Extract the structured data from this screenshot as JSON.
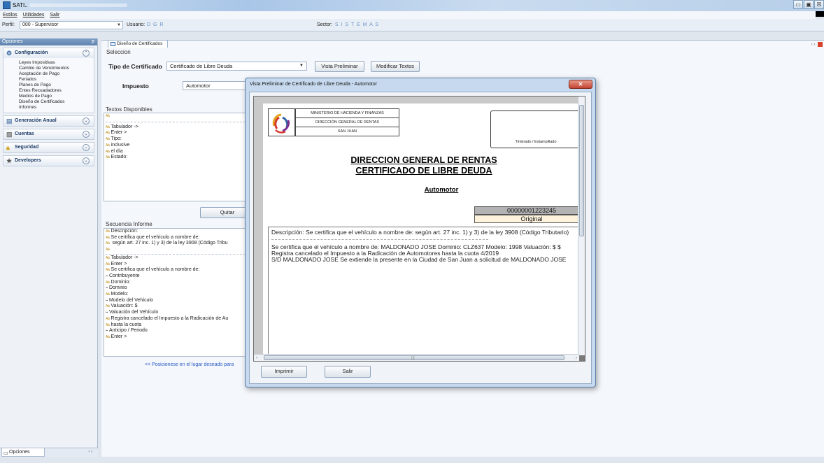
{
  "window": {
    "title": "SATI..",
    "controls": [
      "▭",
      "▣",
      "☒"
    ]
  },
  "menu": [
    "Estilos",
    "Utilidades",
    "Salir"
  ],
  "profile_bar": {
    "perfil_label": "Perfil:",
    "perfil_value": "000 - Supervisor",
    "usuario_label": "Usuario:",
    "usuario_value": "D G R",
    "sector_label": "Sector:",
    "sector_value": "S I S T E M A S"
  },
  "left_panel": {
    "header": "Opciones",
    "pin": "ᵽ",
    "groups": [
      {
        "title": "Configuración",
        "icon": "gear-icon",
        "glyph": "⚙",
        "chevron": "⌃",
        "items": [
          "Leyes Impositivas",
          "Cambio de Vencimientos",
          "Aceptación de Pago",
          "Feriados",
          "Planes de Pago",
          "Entes Recuadadores",
          "Medios de Pago",
          "Diseño de Certificados",
          "Informes"
        ]
      },
      {
        "title": "Generación Anual",
        "icon": "chart-icon",
        "glyph": "▤",
        "chevron": "⌄"
      },
      {
        "title": "Cuentas",
        "icon": "wallet-icon",
        "glyph": "▨",
        "chevron": "⌄"
      },
      {
        "title": "Seguridad",
        "icon": "lock-icon",
        "glyph": "🔒",
        "chevron": "⌄"
      },
      {
        "title": "Developers",
        "icon": "star-icon",
        "glyph": "★",
        "chevron": "⌄"
      }
    ],
    "footer_tab": "Opciones",
    "footer_nav": "‹ ›"
  },
  "document_tab": {
    "label": "Diseño de Certificados",
    "nav": "‹ ›"
  },
  "form": {
    "seleccion_label": "Seleccion",
    "tipo_label": "Tipo de Certificado",
    "tipo_value": "Certificado de Libre Deuda",
    "impuesto_label": "Impuesto",
    "impuesto_value": "Automotor",
    "vista_btn": "Vista Preliminar",
    "modificar_btn": "Modificar Textos",
    "textos_label": "Textos Disponibles",
    "textos": [
      {
        "tk": "Aá",
        "t": ""
      },
      {
        "tk": "Aá",
        "t": "Tabulador ->"
      },
      {
        "tk": "Aá",
        "t": "Enter >"
      },
      {
        "tk": "Aá",
        "t": "Tipo:"
      },
      {
        "tk": "Aá",
        "t": "inclusive"
      },
      {
        "tk": "Aá",
        "t": "el día"
      },
      {
        "tk": "Aá",
        "t": "Estado:"
      }
    ],
    "quitar_btn": "Quitar",
    "secuencia_label": "Secuencia Informe",
    "secuencia": [
      {
        "tk": "Aá",
        "t": "Descripción:"
      },
      {
        "tk": "Aá",
        "t": "Se certifica que el vehículo a nombre de:"
      },
      {
        "tk": "Aá",
        "t": " según art. 27 inc. 1) y 3) de la ley 3908 (Código Tribu"
      },
      {
        "tk": "Aá",
        "t": ""
      },
      {
        "tk": "Aá",
        "t": "Tabulador ->"
      },
      {
        "tk": "Aá",
        "t": "Enter >"
      },
      {
        "tk": "Aá",
        "t": "Se certifica que el vehículo a nombre de:"
      },
      {
        "tk": "f",
        "t": "Contribuyente"
      },
      {
        "tk": "Aá",
        "t": "Dominio:"
      },
      {
        "tk": "f",
        "t": "Dominio"
      },
      {
        "tk": "Aá",
        "t": "Modelo:"
      },
      {
        "tk": "f",
        "t": "Modelo del Vehículo"
      },
      {
        "tk": "Aá",
        "t": "Valuación: $"
      },
      {
        "tk": "f",
        "t": "Valuación del Vehículo"
      },
      {
        "tk": "Aá",
        "t": "Registra cancelado el Impuesto a la Radicación de Au"
      },
      {
        "tk": "Aá",
        "t": "hasta la cuota"
      },
      {
        "tk": "f",
        "t": "Anticipo / Periodo"
      },
      {
        "tk": "Aá",
        "t": "Enter >"
      }
    ],
    "hint": "<< Posicionese en el lugar deseado para"
  },
  "modal": {
    "title": "Vista Preliminar de Certificado de Libre Deuda - Automotor",
    "close": "✕",
    "ministry": [
      "MINISTERIO DE HACIENDA Y FINANZAS",
      "DIRECCIÓN GENERAL DE RENTAS",
      "SAN JUAN"
    ],
    "stamp_label": "Timbrado / Estampillado",
    "heading1": "DIRECCION GENERAL DE RENTAS",
    "heading2": "CERTIFICADO DE LIBRE DEUDA",
    "subheading": "Automotor",
    "number": "00000001223245",
    "original": "Original",
    "descripcion": "Descripción: Se certifica que el vehículo a nombre de:  según art. 27 inc. 1) y 3) de la ley 3908 (Código Tributario)",
    "cuerpo1": "Se certifica que el vehículo a nombre de: MALDONADO JOSE Dominio:  CLZ637 Modelo: 1998 Valuación: $ $",
    "cuerpo2": "Registra cancelado el Impuesto a la Radicación de Automotores hasta la cuota 4/2019",
    "cuerpo3": "S/D MALDONADO JOSE Se extiende la presente en la Ciudad de San Juan a solicitud de MALDONADO JOSE",
    "imprimir_btn": "Imprimir",
    "salir_btn": "Salir",
    "scroll_left": "‹",
    "scroll_mid": "|||",
    "scroll_right": "›"
  }
}
